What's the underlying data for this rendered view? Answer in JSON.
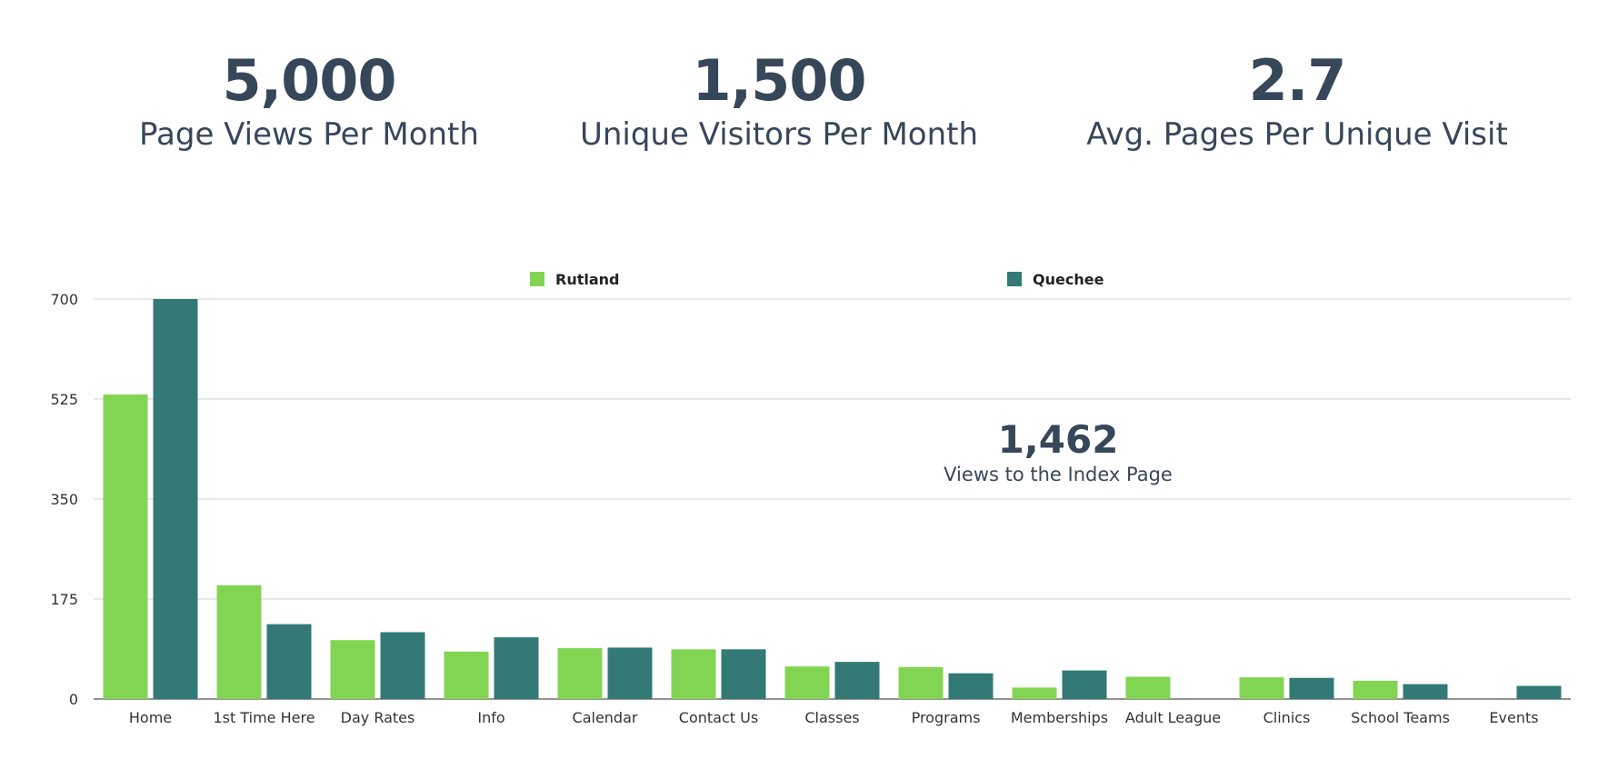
{
  "kpis": [
    {
      "value": "5,000",
      "label": "Page Views Per Month"
    },
    {
      "value": "1,500",
      "label": "Unique Visitors Per Month"
    },
    {
      "value": "2.7",
      "label": "Avg. Pages Per Unique Visit"
    }
  ],
  "chart_data": {
    "type": "bar",
    "categories": [
      "Home",
      "1st Time Here",
      "Day Rates",
      "Info",
      "Calendar",
      "Contact Us",
      "Classes",
      "Programs",
      "Memberships",
      "Adult League",
      "Clinics",
      "School Teams",
      "Events"
    ],
    "series": [
      {
        "name": "Rutland",
        "color": "#82d553",
        "values": [
          533,
          199,
          103,
          83,
          89,
          87,
          57,
          56,
          20,
          39,
          38,
          32,
          0
        ]
      },
      {
        "name": "Quechee",
        "color": "#337a76",
        "values": [
          700,
          131,
          117,
          108,
          90,
          87,
          65,
          45,
          50,
          0,
          37,
          26,
          23
        ]
      }
    ],
    "ylim": [
      0,
      700
    ],
    "yticks": [
      0,
      175,
      350,
      525,
      700
    ],
    "grid": true,
    "legend": "top",
    "annotation": {
      "value": "1,462",
      "label": "Views to the Index Page"
    }
  }
}
